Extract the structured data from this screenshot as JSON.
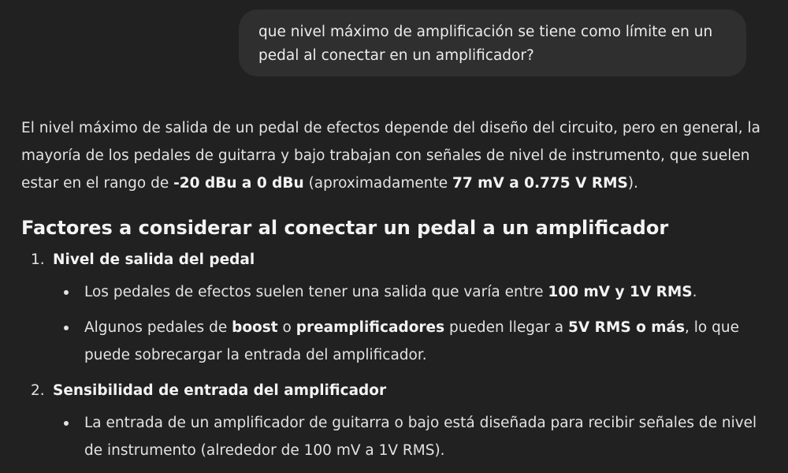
{
  "user_message": "que nivel máximo de amplificación se tiene como límite en un pedal al conectar en un amplificador?",
  "intro": {
    "t1": "El nivel máximo de salida de un pedal de efectos depende del diseño del circuito, pero en general, la mayoría de los pedales de guitarra y bajo trabajan con señales de nivel de instrumento, que suelen estar en el rango de ",
    "b1": "-20 dBu a 0 dBu",
    "t2": " (aproximadamente ",
    "b2": "77 mV a 0.775 V RMS",
    "t3": ")."
  },
  "heading": "Factores a considerar al conectar un pedal a un amplificador",
  "factors": [
    {
      "number": "1.",
      "title": "Nivel de salida del pedal",
      "bullets": [
        {
          "t1": "Los pedales de efectos suelen tener una salida que varía entre ",
          "b1": "100 mV y 1V RMS",
          "t2": "."
        },
        {
          "t1": "Algunos pedales de ",
          "b1": "boost",
          "t2": " o ",
          "b2": "preamplificadores",
          "t3": " pueden llegar a ",
          "b3": "5V RMS o más",
          "t4": ", lo que puede sobrecargar la entrada del amplificador."
        }
      ]
    },
    {
      "number": "2.",
      "title": "Sensibilidad de entrada del amplificador",
      "bullets": [
        {
          "t1": "La entrada de un amplificador de guitarra o bajo está diseñada para recibir señales de nivel de instrumento (alrededor de 100 mV a 1V RMS)."
        }
      ]
    }
  ]
}
